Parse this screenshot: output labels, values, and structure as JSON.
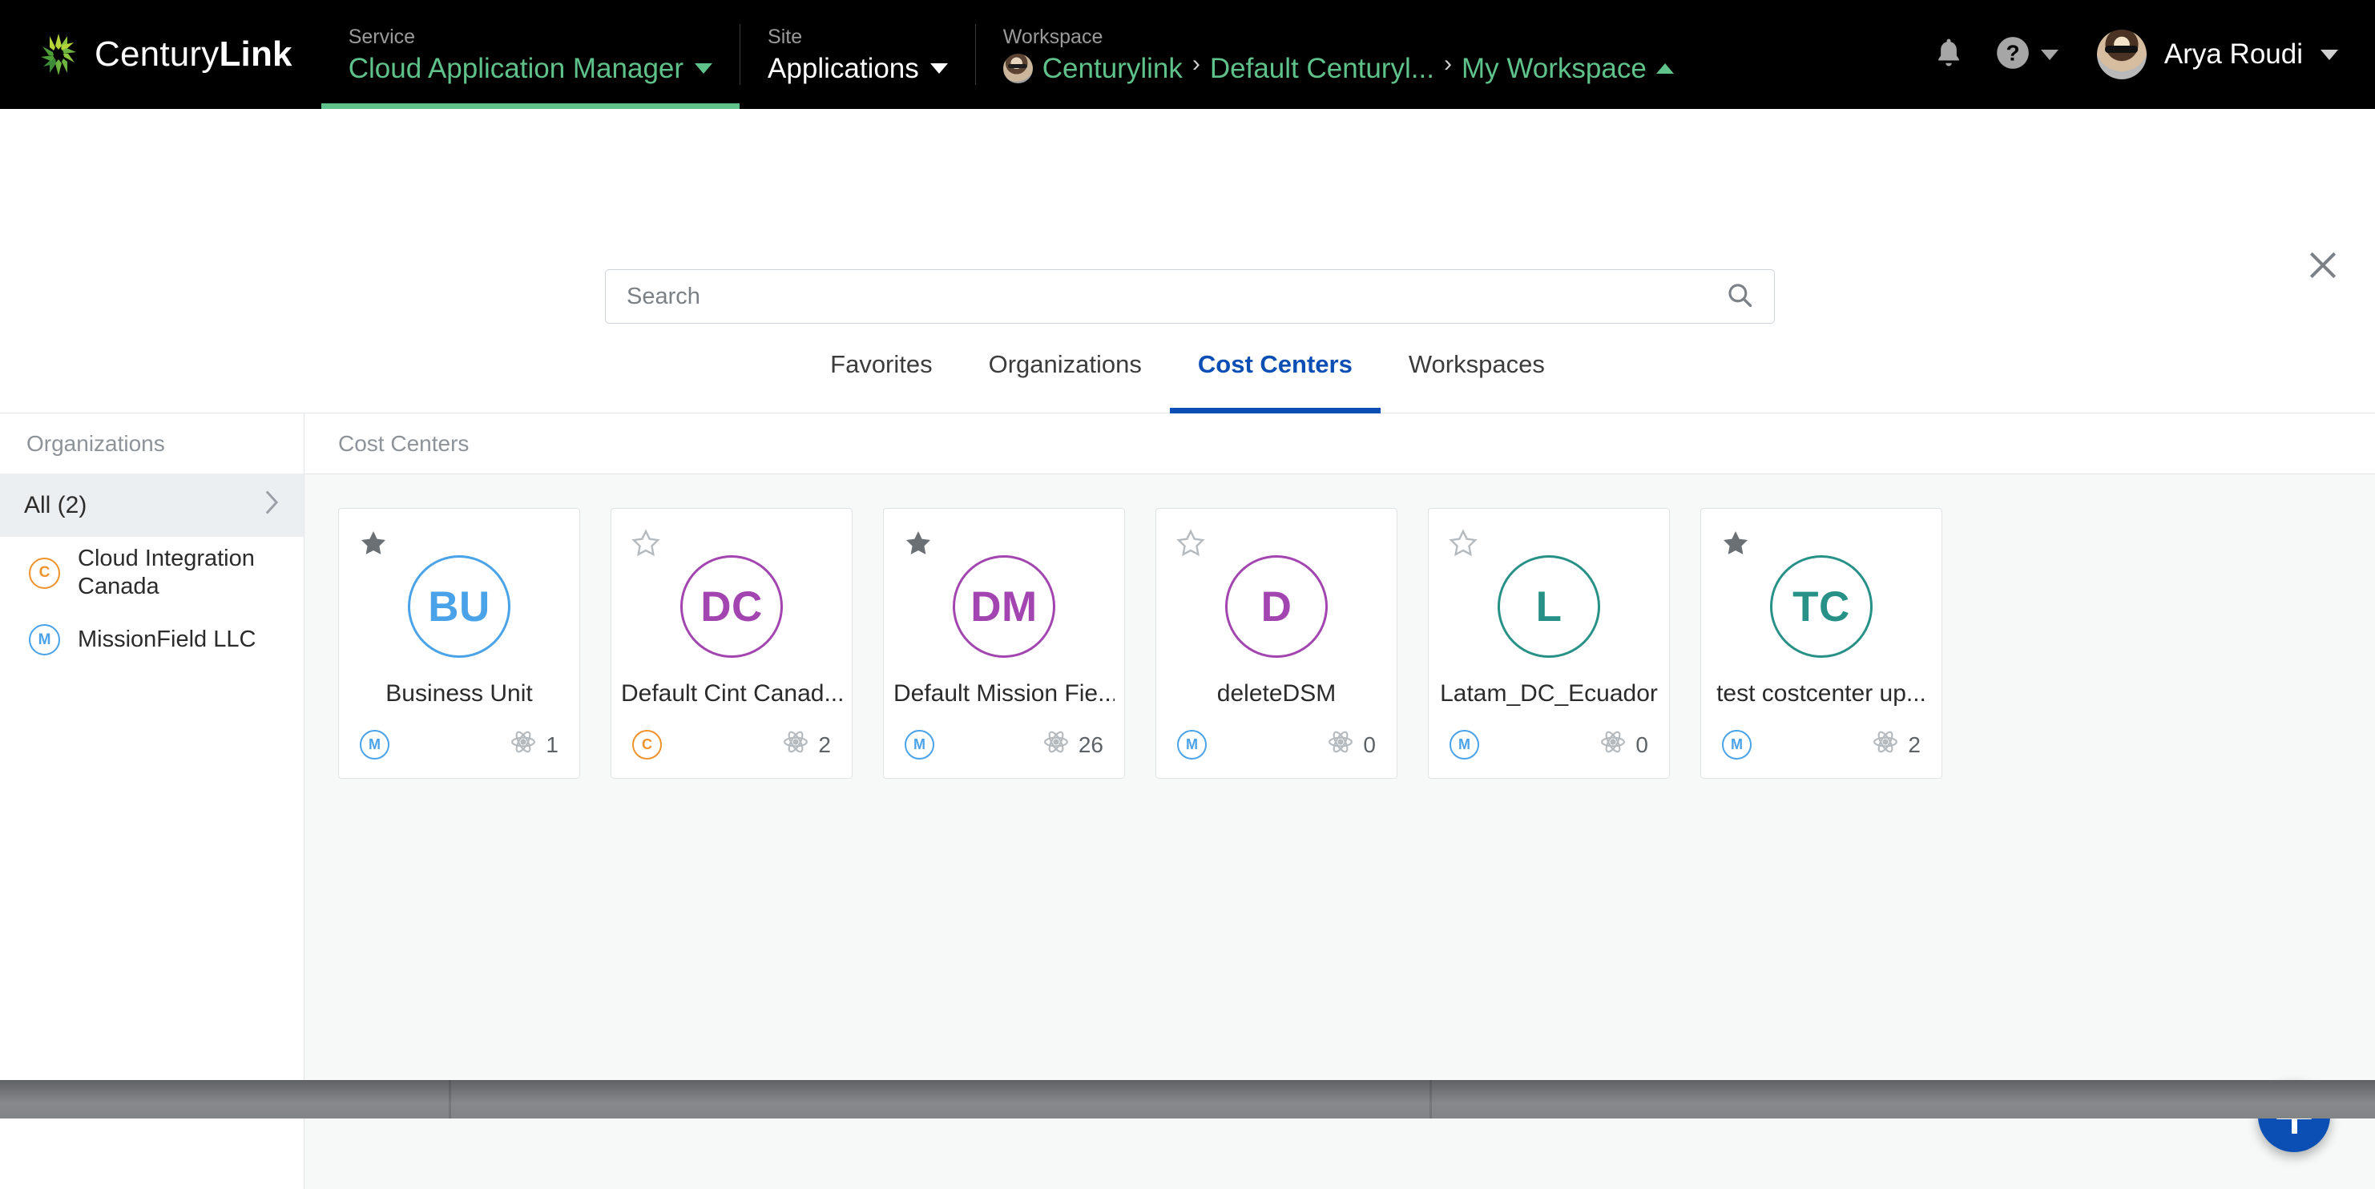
{
  "topbar": {
    "brand": {
      "name_light": "Century",
      "name_bold": "Link",
      "logo_icon": "centurylink-starburst-logo"
    },
    "service": {
      "kicker": "Service",
      "value": "Cloud Application Manager",
      "caret_icon": "chevron-down-icon"
    },
    "site": {
      "kicker": "Site",
      "value": "Applications",
      "caret_icon": "chevron-down-icon"
    },
    "workspace": {
      "kicker": "Workspace",
      "crumb1": "Centurylink",
      "sep1": "›",
      "crumb2": "Default Centuryl...",
      "sep2": "›",
      "crumb3": "My Workspace",
      "caret_icon": "chevron-up-icon",
      "avatar_icon": "workspace-avatar"
    },
    "notifications_icon": "bell-icon",
    "help_icon": "question-mark-help-icon",
    "help_caret_icon": "chevron-down-icon",
    "user": {
      "name": "Arya Roudi",
      "avatar_icon": "user-avatar",
      "caret_icon": "chevron-down-icon"
    }
  },
  "overlay": {
    "close_icon": "close-icon",
    "search": {
      "placeholder": "Search",
      "value": "",
      "icon": "search-icon"
    },
    "tabs": [
      {
        "label": "Favorites",
        "active": false
      },
      {
        "label": "Organizations",
        "active": false
      },
      {
        "label": "Cost Centers",
        "active": true
      },
      {
        "label": "Workspaces",
        "active": false
      }
    ],
    "sidebar": {
      "title": "Organizations",
      "all_label": "All (2)",
      "all_chevron_icon": "chevron-right-icon",
      "items": [
        {
          "initial": "C",
          "label": "Cloud Integration Canada",
          "color": "#f0922b"
        },
        {
          "initial": "M",
          "label": "MissionField LLC",
          "color": "#4aa3e8"
        }
      ]
    },
    "content": {
      "title": "Cost Centers",
      "add_button_icon": "plus-icon",
      "resource_count_icon": "atom-icon",
      "star_filled_icon": "star-filled-icon",
      "star_outline_icon": "star-outline-icon",
      "cards": [
        {
          "initials": "BU",
          "name": "Business Unit",
          "color": "#4aa3e8",
          "favorite": true,
          "org_initial": "M",
          "org_color": "#4aa3e8",
          "count": "1"
        },
        {
          "initials": "DC",
          "name": "Default Cint Canad...",
          "color": "#a martin",
          "favorite": false,
          "org_initial": "C",
          "org_color": "#f0922b",
          "count": "2"
        },
        {
          "initials": "DM",
          "name": "Default Mission Fie...",
          "color": "#a345b0",
          "favorite": true,
          "org_initial": "M",
          "org_color": "#4aa3e8",
          "count": "26"
        },
        {
          "initials": "D",
          "name": "deleteDSM",
          "color": "#a345b0",
          "favorite": false,
          "org_initial": "M",
          "org_color": "#4aa3e8",
          "count": "0"
        },
        {
          "initials": "L",
          "name": "Latam_DC_Ecuador",
          "color": "#289187",
          "favorite": false,
          "org_initial": "M",
          "org_color": "#4aa3e8",
          "count": "0"
        },
        {
          "initials": "TC",
          "name": "test costcenter up...",
          "color": "#289187",
          "favorite": true,
          "org_initial": "M",
          "org_color": "#4aa3e8",
          "count": "2"
        }
      ]
    }
  },
  "colors": {
    "brand_green": "#5fc28a",
    "accent_blue": "#0b4fb5",
    "topbar_bg": "#000000",
    "content_bg": "#f7f9f9",
    "purple": "#a345b0",
    "teal": "#289187",
    "light_blue": "#4aa3e8",
    "orange": "#f0922b"
  }
}
